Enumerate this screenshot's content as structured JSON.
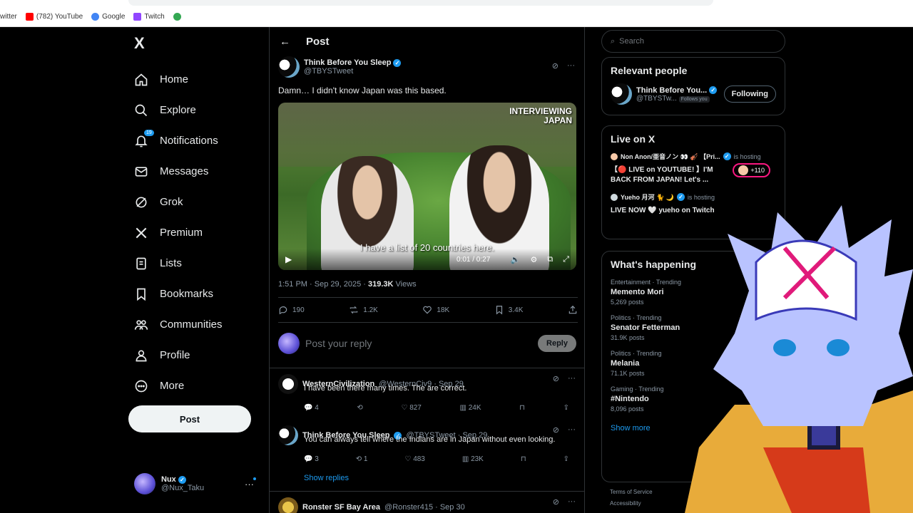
{
  "browser": {
    "bookmarks": [
      {
        "label": "witter",
        "color": "#333"
      },
      {
        "label": "(782) YouTube",
        "color": "#ff0000"
      },
      {
        "label": "Google",
        "color": "#4285f4"
      },
      {
        "label": "Twitch",
        "color": "#9146ff"
      },
      {
        "label": "",
        "color": "#34a853"
      }
    ]
  },
  "nav": {
    "logo": "X",
    "items": [
      {
        "label": "Home",
        "icon": "home-icon"
      },
      {
        "label": "Explore",
        "icon": "search-icon"
      },
      {
        "label": "Notifications",
        "icon": "bell-icon",
        "badge": "19"
      },
      {
        "label": "Messages",
        "icon": "mail-icon"
      },
      {
        "label": "Grok",
        "icon": "grok-icon"
      },
      {
        "label": "Premium",
        "icon": "x-icon"
      },
      {
        "label": "Lists",
        "icon": "list-icon"
      },
      {
        "label": "Bookmarks",
        "icon": "bookmark-icon"
      },
      {
        "label": "Communities",
        "icon": "people-icon"
      },
      {
        "label": "Profile",
        "icon": "person-icon"
      },
      {
        "label": "More",
        "icon": "more-circle-icon"
      }
    ],
    "post_button": "Post",
    "account": {
      "name": "Nux",
      "handle": "@Nux_Taku"
    }
  },
  "main": {
    "header_title": "Post",
    "tweet": {
      "name": "Think Before You Sleep",
      "handle": "@TBYSTweet",
      "text": "Damn… I didn't know Japan was this based.",
      "overlay_text_1": "INTERVIEWING",
      "overlay_text_2": "JAPAN",
      "caption": "I have a list of 20 countries here.",
      "video_time": "0:01 / 0:27",
      "time": "1:51 PM · Sep 29, 2025 · ",
      "views_count": "319.3K",
      "views_label": " Views",
      "replies": "190",
      "reposts": "1.2K",
      "likes": "18K",
      "bookmarks": "3.4K"
    },
    "reply_placeholder": "Post your reply",
    "reply_button": "Reply",
    "replies": [
      {
        "name": "WesternCivilization",
        "handle": "@WesternCiv9 · Sep 29",
        "text": "I have been there many times. The are correct.",
        "replies": "4",
        "reposts": "",
        "likes": "827",
        "views": "24K"
      },
      {
        "name": "Think Before You Sleep",
        "handle": "@TBYSTweet · Sep 29",
        "text": "You can always tell where the Indians are in Japan without even looking.",
        "replies": "3",
        "reposts": "1",
        "likes": "483",
        "views": "23K"
      },
      {
        "name": "Ronster SF Bay Area",
        "handle": "@Ronster415 · Sep 30",
        "text": ""
      }
    ],
    "show_replies": "Show replies"
  },
  "right": {
    "search_placeholder": "Search",
    "relevant_title": "Relevant people",
    "relevant_person": {
      "name": "Think Before You...",
      "handle": "@TBYSTw...",
      "follows_you": "Follows you",
      "button": "Following"
    },
    "live_title": "Live on X",
    "live": [
      {
        "host": "Non Anon/亜音ノン 👀 🎻 【Pri...",
        "status": "is hosting",
        "text": "【🔴 LIVE on YOUTUBE! 】I'M BACK FROM JAPAN! Let's ...",
        "count": "+110"
      },
      {
        "host": "Yueho 月河 🐈 🌙",
        "status": "is hosting",
        "text": "LIVE NOW 🤍 yueho on Twitch"
      }
    ],
    "happening_title": "What's happening",
    "trends": [
      {
        "cat": "Entertainment · Trending",
        "name": "Memento Mori",
        "posts": "5,269 posts"
      },
      {
        "cat": "Politics · Trending",
        "name": "Senator Fetterman",
        "posts": "31.9K posts"
      },
      {
        "cat": "Politics · Trending",
        "name": "Melania",
        "posts": "71.1K posts"
      },
      {
        "cat": "Gaming · Trending",
        "name": "#Nintendo",
        "posts": "8,096 posts"
      }
    ],
    "show_more": "Show more",
    "footer1": "Terms of Service",
    "footer2": "Accessibility"
  }
}
